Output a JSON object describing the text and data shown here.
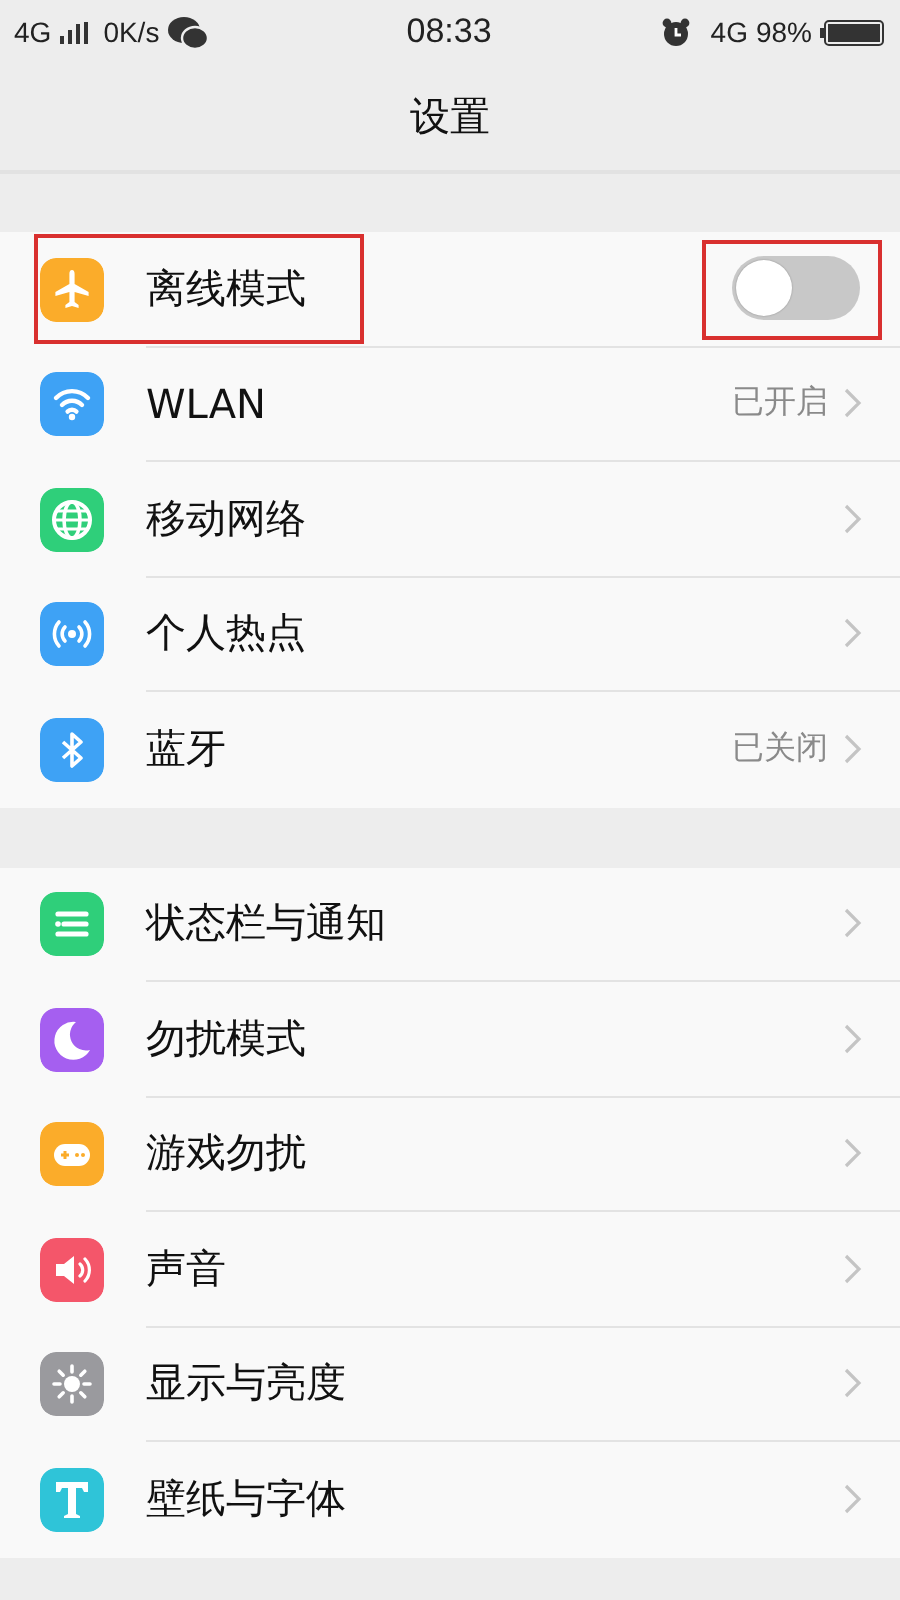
{
  "status_bar": {
    "network": "4G",
    "speed": "0K/s",
    "time": "08:33",
    "data_network": "4G",
    "battery": "98%"
  },
  "title": "设置",
  "groups": [
    {
      "items": [
        {
          "kind": "toggle",
          "label": "离线模式",
          "color": "#fbac2a",
          "on": false,
          "highlighted": true
        },
        {
          "kind": "link",
          "label": "WLAN",
          "color": "#3ea2f5",
          "value": "已开启"
        },
        {
          "kind": "link",
          "label": "移动网络",
          "color": "#2fcf7a"
        },
        {
          "kind": "link",
          "label": "个人热点",
          "color": "#3ea2f5"
        },
        {
          "kind": "link",
          "label": "蓝牙",
          "color": "#3ea2f5",
          "value": "已关闭"
        }
      ]
    },
    {
      "items": [
        {
          "kind": "link",
          "label": "状态栏与通知",
          "color": "#2fcf7a"
        },
        {
          "kind": "link",
          "label": "勿扰模式",
          "color": "#a55ff0"
        },
        {
          "kind": "link",
          "label": "游戏勿扰",
          "color": "#fbac2a"
        },
        {
          "kind": "link",
          "label": "声音",
          "color": "#f4566a"
        },
        {
          "kind": "link",
          "label": "显示与亮度",
          "color": "#9a9a9e"
        },
        {
          "kind": "link",
          "label": "壁纸与字体",
          "color": "#2fc4d8"
        }
      ]
    }
  ]
}
